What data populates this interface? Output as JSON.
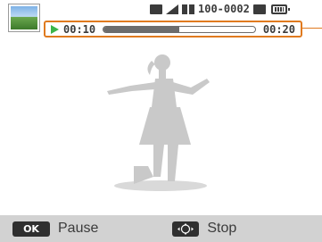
{
  "thumbnail": {
    "icon": "landscape-thumbnail-icon"
  },
  "status": {
    "icons": [
      "memory-icon",
      "signal-icon",
      "grid-icon"
    ],
    "file_number": "100-0002",
    "battery_icon": "battery-icon"
  },
  "playback": {
    "elapsed": "00:10",
    "total": "00:20",
    "progress": 0.5,
    "play_icon": "play-icon",
    "accent_color": "#e07a1f",
    "play_color": "#3bb54a"
  },
  "controls": {
    "pause_button": "OK",
    "pause_label": "Pause",
    "stop_icon": "dpad-icon",
    "stop_label": "Stop"
  }
}
